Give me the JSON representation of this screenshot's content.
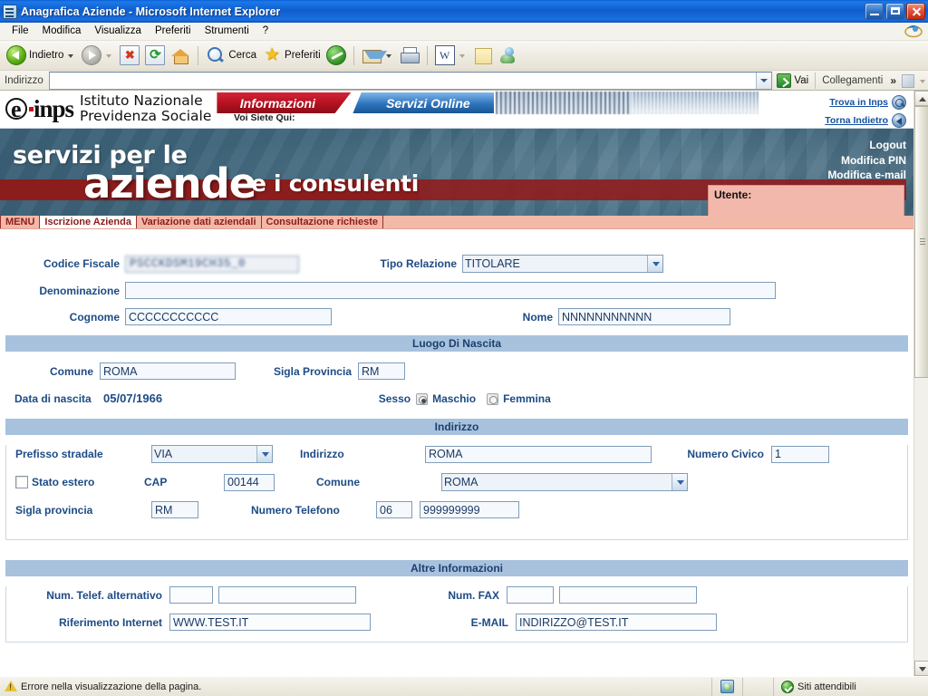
{
  "window": {
    "title": "Anagrafica Aziende - Microsoft Internet Explorer",
    "icon": "ie-document-icon",
    "minimize_label": "Minimize",
    "maximize_label": "Maximize",
    "close_label": "Close"
  },
  "menubar": {
    "items": [
      {
        "label": "File"
      },
      {
        "label": "Modifica"
      },
      {
        "label": "Visualizza"
      },
      {
        "label": "Preferiti"
      },
      {
        "label": "Strumenti"
      },
      {
        "label": "?"
      }
    ]
  },
  "toolbar": {
    "back_label": "Indietro",
    "forward_label": "",
    "stop_label": "",
    "refresh_label": "",
    "home_label": "",
    "search_label": "Cerca",
    "favorites_label": "Preferiti",
    "history_label": "",
    "mail_label": "",
    "print_label": "",
    "edit_label": "",
    "notes_label": "",
    "messenger_label": ""
  },
  "address_bar": {
    "label": "Indirizzo",
    "value": "",
    "placeholder": "",
    "go_label": "Vai",
    "links_label": "Collegamenti",
    "more_label": "»"
  },
  "site_header": {
    "logo_text": "inps",
    "logo_mark": "e",
    "institute_line1": "Istituto Nazionale",
    "institute_line2": "Previdenza Sociale",
    "tab_informazioni": "Informazioni",
    "tab_servizi_online": "Servizi Online",
    "breadcrumb_label": "Voi Siete Qui:",
    "link_find": "Trova in Inps",
    "link_back": "Torna Indietro"
  },
  "banner": {
    "line1": "servizi per le",
    "line2": "aziende",
    "line3": "e i consulenti",
    "account_links": [
      "Logout",
      "Modifica PIN",
      "Modifica e-mail"
    ],
    "user_label": "Utente:",
    "user_value": ""
  },
  "app_menu": {
    "items": [
      {
        "label": "MENU",
        "active": false
      },
      {
        "label": "Iscrizione Azienda",
        "active": true
      },
      {
        "label": "Variazione dati aziendali",
        "active": false
      },
      {
        "label": "Consultazione richieste",
        "active": false
      }
    ]
  },
  "form": {
    "identity": {
      "codice_fiscale_label": "Codice Fiscale",
      "codice_fiscale_value": "PSCCKDSM19CH35_0",
      "tipo_relazione_label": "Tipo Relazione",
      "tipo_relazione_value": "TITOLARE",
      "tipo_relazione_options": [
        "TITOLARE"
      ],
      "denominazione_label": "Denominazione",
      "denominazione_value": "",
      "cognome_label": "Cognome",
      "cognome_value": "CCCCCCCCCCC",
      "nome_label": "Nome",
      "nome_value": "NNNNNNNNNNN"
    },
    "luogo_nascita": {
      "section_title": "Luogo Di Nascita",
      "comune_label": "Comune",
      "comune_value": "ROMA",
      "sigla_provincia_label": "Sigla Provincia",
      "sigla_provincia_value": "RM",
      "data_nascita_label": "Data di nascita",
      "data_nascita_value": "05/07/1966",
      "sesso_label": "Sesso",
      "sesso_maschio_label": "Maschio",
      "sesso_femmina_label": "Femmina",
      "sesso_selected": "Maschio"
    },
    "indirizzo": {
      "section_title": "Indirizzo",
      "prefisso_label": "Prefisso stradale",
      "prefisso_value": "VIA",
      "prefisso_options": [
        "VIA"
      ],
      "indirizzo_label": "Indirizzo",
      "indirizzo_value": "ROMA",
      "numero_civico_label": "Numero Civico",
      "numero_civico_value": "1",
      "stato_estero_label": "Stato estero",
      "stato_estero_checked": false,
      "cap_label": "CAP",
      "cap_value": "00144",
      "comune_label": "Comune",
      "comune_value": "ROMA",
      "comune_options": [
        "ROMA"
      ],
      "sigla_provincia_label": "Sigla provincia",
      "sigla_provincia_value": "RM",
      "numero_telefono_label": "Numero Telefono",
      "telefono_prefisso_value": "06",
      "telefono_numero_value": "999999999"
    },
    "altre_informazioni": {
      "section_title": "Altre Informazioni",
      "telef_alt_label": "Num. Telef. alternativo",
      "telef_alt_prefisso": "",
      "telef_alt_numero": "",
      "fax_label": "Num. FAX",
      "fax_prefisso": "",
      "fax_numero": "",
      "riferimento_internet_label": "Riferimento Internet",
      "riferimento_internet_value": "WWW.TEST.IT",
      "email_label": "E-MAIL",
      "email_value": "INDIRIZZO@TEST.IT"
    }
  },
  "status_bar": {
    "message": "Errore nella visualizzazione della pagina.",
    "zone_label": "Siti attendibili"
  },
  "colors": {
    "titlebar_blue": "#0f5ecd",
    "banner_slate": "#3d6277",
    "banner_red": "#8d1e1e",
    "section_header_blue": "#a8c2dd",
    "label_blue": "#1d4b85",
    "menu_peach": "#f2b8a8",
    "link_blue": "#1450a0"
  }
}
